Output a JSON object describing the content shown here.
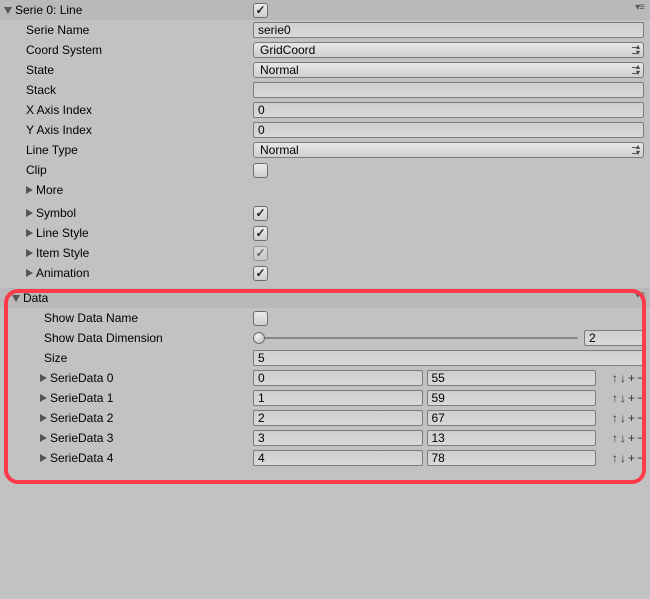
{
  "header": {
    "title": "Serie 0: Line",
    "checked": true
  },
  "fields": {
    "serieName": {
      "label": "Serie Name",
      "value": "serie0"
    },
    "coordSystem": {
      "label": "Coord System",
      "value": "GridCoord"
    },
    "state": {
      "label": "State",
      "value": "Normal"
    },
    "stack": {
      "label": "Stack",
      "value": ""
    },
    "xAxisIndex": {
      "label": "X Axis Index",
      "value": "0"
    },
    "yAxisIndex": {
      "label": "Y Axis Index",
      "value": "0"
    },
    "lineType": {
      "label": "Line Type",
      "value": "Normal"
    },
    "clip": {
      "label": "Clip",
      "checked": false
    }
  },
  "subsections": {
    "more": {
      "label": "More"
    },
    "symbol": {
      "label": "Symbol",
      "checked": true
    },
    "lineStyle": {
      "label": "Line Style",
      "checked": true
    },
    "itemStyle": {
      "label": "Item Style",
      "checked": true,
      "dim": true
    },
    "animation": {
      "label": "Animation",
      "checked": true
    }
  },
  "data": {
    "label": "Data",
    "showDataName": {
      "label": "Show Data Name",
      "checked": false
    },
    "showDataDimension": {
      "label": "Show Data Dimension",
      "value": "2"
    },
    "size": {
      "label": "Size",
      "value": "5"
    },
    "rows": [
      {
        "label": "SerieData 0",
        "a": "0",
        "b": "55"
      },
      {
        "label": "SerieData 1",
        "a": "1",
        "b": "59"
      },
      {
        "label": "SerieData 2",
        "a": "2",
        "b": "67"
      },
      {
        "label": "SerieData 3",
        "a": "3",
        "b": "13"
      },
      {
        "label": "SerieData 4",
        "a": "4",
        "b": "78"
      }
    ],
    "actions": {
      "up": "↑",
      "down": "↓",
      "add": "+",
      "remove": "−"
    }
  },
  "gearIcon": "▾≡"
}
